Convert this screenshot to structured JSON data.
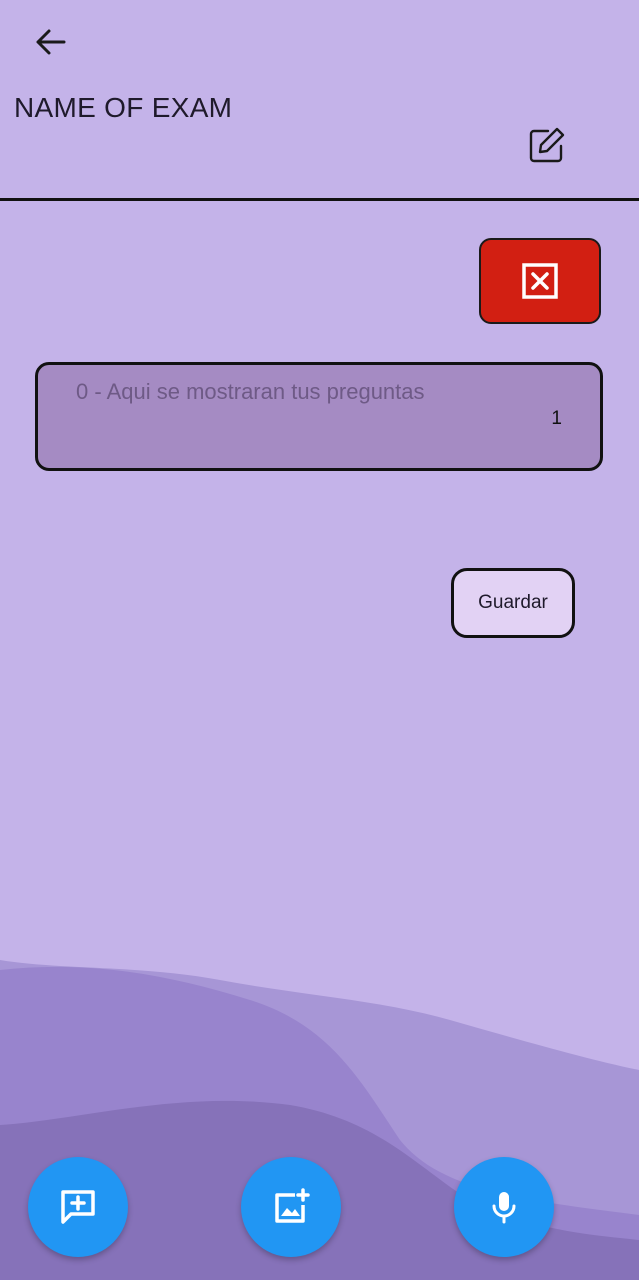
{
  "header": {
    "back_icon": "arrow-back-icon",
    "title": "NAME OF EXAM",
    "edit_icon": "edit-note-icon"
  },
  "delete_button": {
    "icon": "close-box-icon",
    "color": "#d21f12"
  },
  "question_card": {
    "placeholder": "0 - Aqui se mostraran tus preguntas",
    "count": "1"
  },
  "save_button": {
    "label": "Guardar"
  },
  "fabs": [
    {
      "icon": "add-comment-icon",
      "color": "#2196f3"
    },
    {
      "icon": "add-photo-icon",
      "color": "#2196f3"
    },
    {
      "icon": "mic-icon",
      "color": "#2196f3"
    }
  ],
  "colors": {
    "background": "#c4b3e9",
    "card": "#a58bc3",
    "save_button_bg": "#e2d2f4"
  }
}
